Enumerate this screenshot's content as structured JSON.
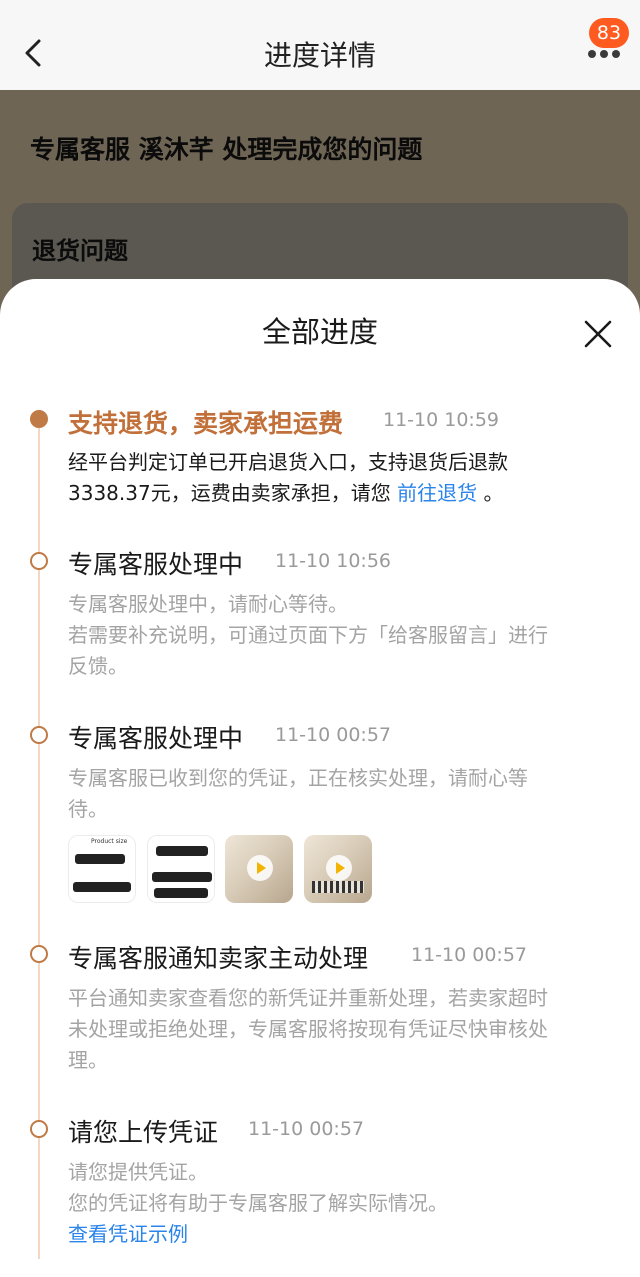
{
  "nav": {
    "back_icon": "back-arrow-icon",
    "title": "进度详情",
    "more_icon": "more-dots-icon",
    "badge_count": "83"
  },
  "background": {
    "headline": "专属客服 溪沐芊 处理完成您的问题",
    "card_title": "退货问题"
  },
  "sheet": {
    "title": "全部进度",
    "close_icon": "close-icon",
    "accent_color": "#c2703a",
    "link_color": "#2a84ea",
    "events": [
      {
        "title": "支持退货，卖家承担运费",
        "time": "11-10 10:59",
        "lines": [
          "经平台判定订单已开启退货入口，支持退货后退款",
          "3338.37元，运费由卖家承担，请您"
        ],
        "link": "前往退货",
        "suffix": "。"
      },
      {
        "title": "专属客服处理中",
        "time": "11-10 10:56",
        "lines": [
          "专属客服处理中，请耐心等待。",
          "若需要补充说明，可通过页面下方「给客服留言」进行",
          "反馈。"
        ]
      },
      {
        "title": "专属客服处理中",
        "time": "11-10 00:57",
        "lines": [
          "专属客服已收到您的凭证，正在核实处理，请耐心等",
          "待。"
        ],
        "attachments": [
          {
            "kind": "image",
            "caption": "Product size"
          },
          {
            "kind": "image"
          },
          {
            "kind": "video"
          },
          {
            "kind": "video"
          }
        ]
      },
      {
        "title": "专属客服通知卖家主动处理",
        "time": "11-10 00:57",
        "lines": [
          "平台通知卖家查看您的新凭证并重新处理，若卖家超时",
          "未处理或拒绝处理，专属客服将按现有凭证尽快审核处",
          "理。"
        ]
      },
      {
        "title": "请您上传凭证",
        "time": "11-10 00:57",
        "lines": [
          "请您提供凭证。",
          "您的凭证将有助于专属客服了解实际情况。"
        ],
        "link": "查看凭证示例"
      }
    ]
  }
}
